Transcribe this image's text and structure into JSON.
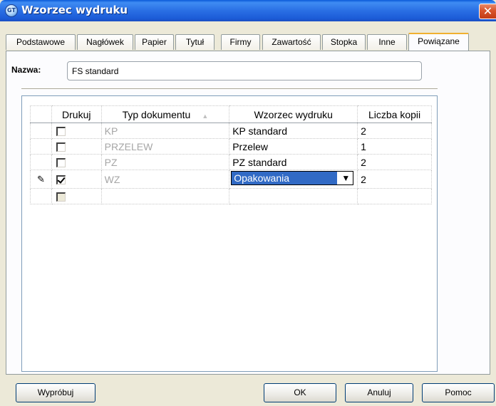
{
  "window": {
    "title": "Wzorzec wydruku",
    "close_label": "✕"
  },
  "tabs": [
    {
      "label": "Podstawowe"
    },
    {
      "label": "Nagłówek"
    },
    {
      "label": "Papier"
    },
    {
      "label": "Tytuł"
    },
    {
      "label": "Firmy"
    },
    {
      "label": "Zawartość"
    },
    {
      "label": "Stopka"
    },
    {
      "label": "Inne"
    },
    {
      "label": "Powiązane"
    }
  ],
  "active_tab": "Powiązane",
  "form": {
    "nazwa_label": "Nazwa:",
    "nazwa_value": "FS standard"
  },
  "grid": {
    "columns": {
      "drukuj": "Drukuj",
      "typ": "Typ dokumentu",
      "wzorzec": "Wzorzec wydruku",
      "kopie": "Liczba kopii"
    },
    "rows": [
      {
        "drukuj": false,
        "typ": "KP",
        "wzorzec": "KP standard",
        "kopie": "2"
      },
      {
        "drukuj": false,
        "typ": "PRZELEW",
        "wzorzec": "Przelew",
        "kopie": "1"
      },
      {
        "drukuj": false,
        "typ": "PZ",
        "wzorzec": "PZ standard",
        "kopie": "2"
      },
      {
        "drukuj": true,
        "typ": "WZ",
        "wzorzec": "Opakowania",
        "kopie": "2",
        "editing": true
      },
      {
        "drukuj": false,
        "typ": "",
        "wzorzec": "",
        "kopie": ""
      }
    ]
  },
  "buttons": {
    "try": "Wypróbuj",
    "ok": "OK",
    "cancel": "Anuluj",
    "help": "Pomoc"
  },
  "colors": {
    "titlebar": "#2a6fe4",
    "selection": "#316ac5",
    "active_tab_accent": "#f0b030"
  }
}
